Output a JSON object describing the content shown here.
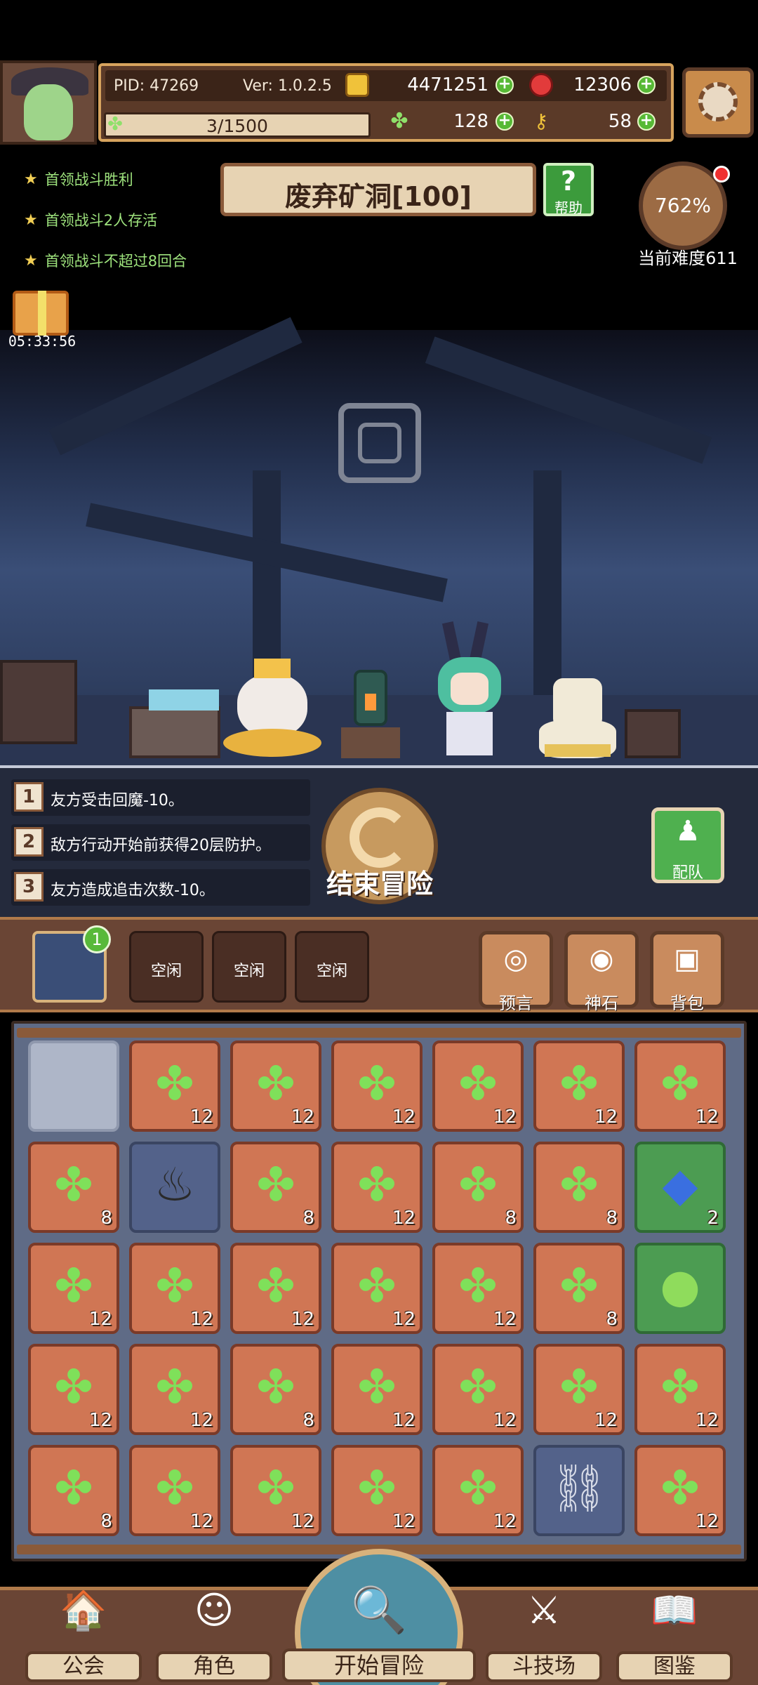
{
  "header": {
    "pid": "PID: 47269",
    "version": "Ver: 1.0.2.5",
    "gold": "4471251",
    "gems": "12306",
    "stamina": "3/1500",
    "clovers": "128",
    "keys": "58"
  },
  "quests": [
    "首领战斗胜利",
    "首领战斗2人存活",
    "首领战斗不超过8回合"
  ],
  "stage": {
    "title": "废弃矿洞[100]",
    "help_label": "帮助",
    "difficulty_percent": "762%",
    "difficulty_label": "当前难度611",
    "gift_timer": "05:33:56"
  },
  "buffs": [
    {
      "num": "1",
      "text": "友方受击回魔-10。"
    },
    {
      "num": "2",
      "text": "敌方行动开始前获得20层防护。"
    },
    {
      "num": "3",
      "text": "友方造成追击次数-10。"
    }
  ],
  "actions": {
    "end_adventure": "结束冒险",
    "formation": "配队"
  },
  "slots": {
    "hero_badge": "1",
    "idle": [
      "空闲",
      "空闲",
      "空闲"
    ],
    "buttons": [
      "预言",
      "神石",
      "背包"
    ]
  },
  "inventory": [
    [
      {
        "t": "empty",
        "q": ""
      },
      {
        "t": "clover",
        "q": "12"
      },
      {
        "t": "clover",
        "q": "12"
      },
      {
        "t": "clover",
        "q": "12"
      },
      {
        "t": "clover",
        "q": "12"
      },
      {
        "t": "clover",
        "q": "12"
      },
      {
        "t": "clover",
        "q": "12"
      }
    ],
    [
      {
        "t": "clover",
        "q": "8"
      },
      {
        "t": "cauldron",
        "q": ""
      },
      {
        "t": "clover",
        "q": "8"
      },
      {
        "t": "clover",
        "q": "12"
      },
      {
        "t": "clover",
        "q": "8"
      },
      {
        "t": "clover",
        "q": "8"
      },
      {
        "t": "gem-amulet",
        "q": "2"
      }
    ],
    [
      {
        "t": "clover",
        "q": "12"
      },
      {
        "t": "clover",
        "q": "12"
      },
      {
        "t": "clover",
        "q": "12"
      },
      {
        "t": "clover",
        "q": "12"
      },
      {
        "t": "clover",
        "q": "12"
      },
      {
        "t": "clover",
        "q": "8"
      },
      {
        "t": "slime",
        "q": ""
      }
    ],
    [
      {
        "t": "clover",
        "q": "12"
      },
      {
        "t": "clover",
        "q": "12"
      },
      {
        "t": "clover",
        "q": "8"
      },
      {
        "t": "clover",
        "q": "12"
      },
      {
        "t": "clover",
        "q": "12"
      },
      {
        "t": "clover",
        "q": "12"
      },
      {
        "t": "clover",
        "q": "12"
      }
    ],
    [
      {
        "t": "clover",
        "q": "8"
      },
      {
        "t": "clover",
        "q": "12"
      },
      {
        "t": "clover",
        "q": "12"
      },
      {
        "t": "clover",
        "q": "12"
      },
      {
        "t": "clover",
        "q": "12"
      },
      {
        "t": "chest",
        "q": ""
      },
      {
        "t": "clover",
        "q": "12"
      }
    ]
  ],
  "nav": {
    "guild": "公会",
    "character": "角色",
    "start_adventure": "开始冒险",
    "arena": "斗技场",
    "codex": "图鉴"
  }
}
